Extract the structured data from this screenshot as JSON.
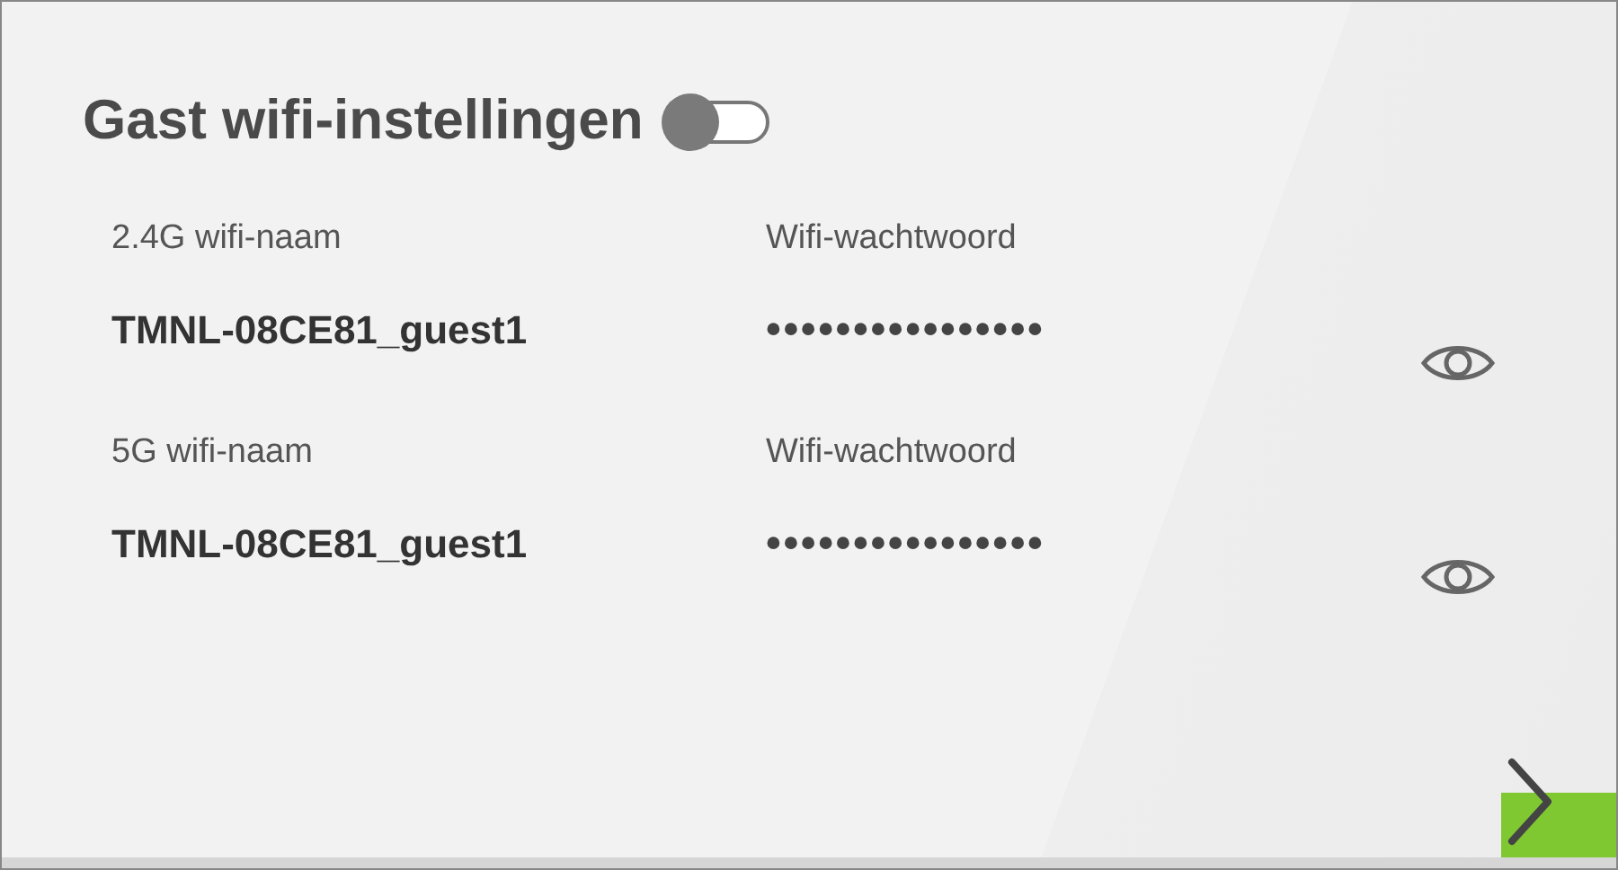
{
  "title": "Gast wifi-instellingen",
  "toggle": {
    "on": false
  },
  "networks": [
    {
      "name_label": "2.4G wifi-naam",
      "name": "TMNL-08CE81_guest1",
      "password_label": "Wifi-wachtwoord",
      "password": "••••••••••••••••"
    },
    {
      "name_label": "5G wifi-naam",
      "name": "TMNL-08CE81_guest1",
      "password_label": "Wifi-wachtwoord",
      "password": "••••••••••••••••"
    }
  ]
}
